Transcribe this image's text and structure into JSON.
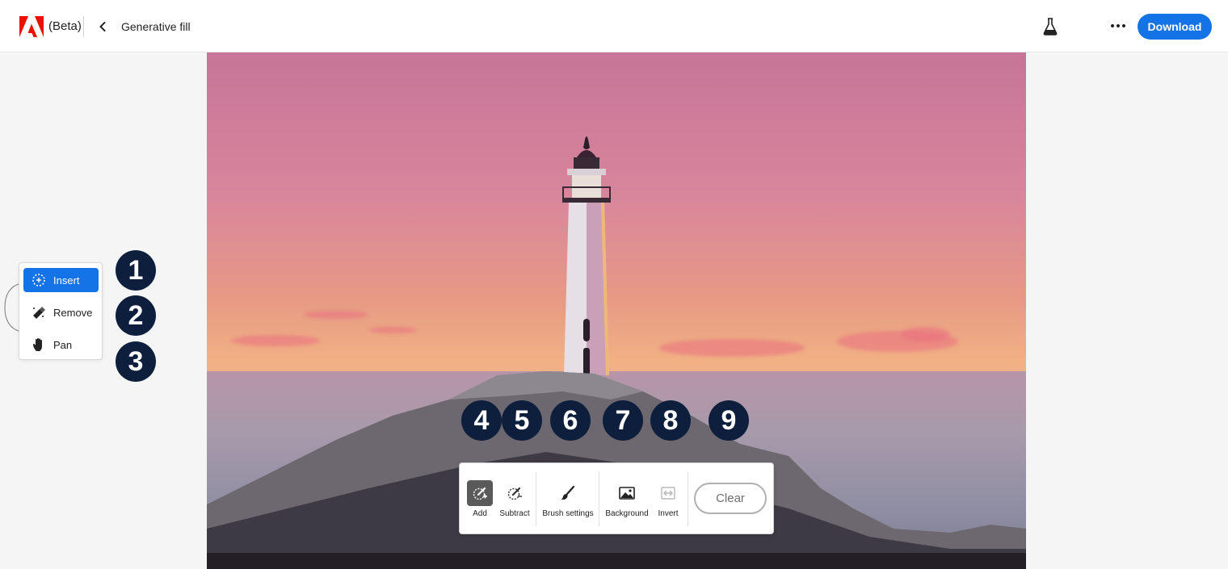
{
  "header": {
    "brand_badge": "(Beta)",
    "title": "Generative fill",
    "download_label": "Download",
    "logo_icon": "adobe-logo",
    "back_icon": "chevron-left-icon",
    "labs_icon": "flask-icon",
    "more_icon": "more-dots-icon",
    "accent_color": "#1473e6"
  },
  "tools": {
    "items": [
      {
        "label": "Insert",
        "icon": "insert-brush-icon",
        "active": true
      },
      {
        "label": "Remove",
        "icon": "eraser-icon",
        "active": false
      },
      {
        "label": "Pan",
        "icon": "hand-icon",
        "active": false
      }
    ]
  },
  "callouts": [
    "1",
    "2",
    "3",
    "4",
    "5",
    "6",
    "7",
    "8",
    "9"
  ],
  "toolbar": {
    "add_label": "Add",
    "subtract_label": "Subtract",
    "brush_settings_label": "Brush settings",
    "background_label": "Background",
    "invert_label": "Invert",
    "clear_label": "Clear"
  }
}
